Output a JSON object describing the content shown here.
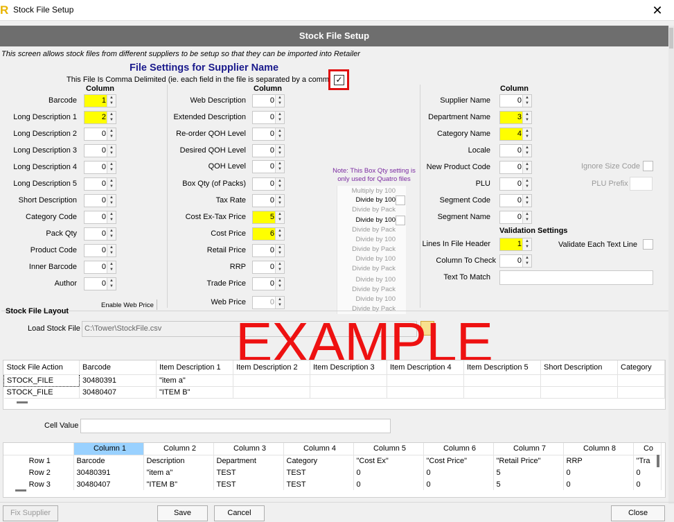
{
  "window": {
    "app_logo": "R",
    "title": "Stock File Setup",
    "close_glyph": "✕"
  },
  "banner": "Stock File Setup",
  "description": "This screen allows stock files from different suppliers to be setup so that they can be imported into Retailer",
  "file_settings_title": "File Settings for Supplier Name",
  "comma_delimited": {
    "label": "This File Is Comma Delimited (ie. each field in the file is separated by a comma)",
    "checked": true,
    "check_glyph": "✓"
  },
  "column_header": "Column",
  "spin_up": "▲",
  "spin_down": "▼",
  "left_fields": [
    {
      "label": "Barcode",
      "value": "1",
      "highlight": true
    },
    {
      "label": "Long Description 1",
      "value": "2",
      "highlight": true
    },
    {
      "label": "Long Description 2",
      "value": "0"
    },
    {
      "label": "Long Description 3",
      "value": "0"
    },
    {
      "label": "Long Description 4",
      "value": "0"
    },
    {
      "label": "Long Description 5",
      "value": "0"
    },
    {
      "label": "Short Description",
      "value": "0"
    },
    {
      "label": "Category Code",
      "value": "0"
    },
    {
      "label": "Pack Qty",
      "value": "0"
    },
    {
      "label": "Product Code",
      "value": "0"
    },
    {
      "label": "Inner Barcode",
      "value": "0"
    },
    {
      "label": "Author",
      "value": "0"
    }
  ],
  "middle_fields": [
    {
      "label": "Web Description",
      "value": "0"
    },
    {
      "label": "Extended Description",
      "value": "0"
    },
    {
      "label": "Re-order QOH Level",
      "value": "0"
    },
    {
      "label": "Desired QOH Level",
      "value": "0"
    },
    {
      "label": "QOH Level",
      "value": "0"
    },
    {
      "label": "Box Qty (of Packs)",
      "value": "0"
    },
    {
      "label": "Tax Rate",
      "value": "0"
    },
    {
      "label": "Cost Ex-Tax Price",
      "value": "5",
      "highlight": true
    },
    {
      "label": "Cost Price",
      "value": "6",
      "highlight": true
    },
    {
      "label": "Retail Price",
      "value": "0"
    },
    {
      "label": "RRP",
      "value": "0"
    },
    {
      "label": "Trade Price",
      "value": "0"
    },
    {
      "label": "Web Price",
      "value": "0",
      "disabled": true
    }
  ],
  "enable_web_price": "Enable Web Price",
  "box_qty_note": "Note: This Box Qty setting is only used for Quatro files",
  "box_qty_options": [
    {
      "text": "Multiply by 100",
      "active": false
    },
    {
      "text": "Divide by 100",
      "active": true
    },
    {
      "text": "Divide by Pack",
      "active": false
    },
    {
      "text": "Divide by 100",
      "active": true
    },
    {
      "text": "Divide by Pack",
      "active": false
    },
    {
      "text": "Divide by 100",
      "active": false
    },
    {
      "text": "Divide by Pack",
      "active": false
    },
    {
      "text": "Divide by 100",
      "active": false
    },
    {
      "text": "Divide by Pack",
      "active": false
    },
    {
      "text": "Divide by 100",
      "active": false
    },
    {
      "text": "Divide by Pack",
      "active": false
    },
    {
      "text": "Divide by 100",
      "active": false
    },
    {
      "text": "Divide by Pack",
      "active": false
    }
  ],
  "right_fields": [
    {
      "label": "Supplier Name",
      "value": "0"
    },
    {
      "label": "Department Name",
      "value": "3",
      "highlight": true
    },
    {
      "label": "Category Name",
      "value": "4",
      "highlight": true
    },
    {
      "label": "Locale",
      "value": "0"
    },
    {
      "label": "New Product Code",
      "value": "0"
    },
    {
      "label": "PLU",
      "value": "0"
    },
    {
      "label": "Segment Code",
      "value": "0"
    },
    {
      "label": "Segment Name",
      "value": "0"
    }
  ],
  "ignore_size_code": "Ignore Size Code",
  "plu_prefix": "PLU Prefix",
  "validation": {
    "title": "Validation Settings",
    "lines_in_header_label": "Lines In File Header",
    "lines_in_header_value": "1",
    "column_to_check_label": "Column To Check",
    "column_to_check_value": "0",
    "text_to_match_label": "Text To Match",
    "text_to_match_value": "",
    "validate_each_label": "Validate Each Text Line"
  },
  "stock_file_layout": {
    "title": "Stock File Layout",
    "load_label": "Load Stock File",
    "path": "C:\\Tower\\StockFile.csv"
  },
  "watermark": "EXAMPLE",
  "grid1": {
    "columns": [
      "Stock File Action",
      "Barcode",
      "Item Description 1",
      "Item Description 2",
      "Item Description 3",
      "Item Description 4",
      "Item Description 5",
      "Short Description",
      "Category"
    ],
    "rows": [
      [
        "STOCK_FILE",
        "30480391",
        "\"item a\"",
        "",
        "",
        "",
        "",
        "",
        ""
      ],
      [
        "STOCK_FILE",
        "30480407",
        "\"ITEM B\"",
        "",
        "",
        "",
        "",
        "",
        ""
      ]
    ]
  },
  "cell_value": {
    "label": "Cell Value",
    "value": ""
  },
  "grid2": {
    "columns": [
      "Column 1",
      "Column 2",
      "Column 3",
      "Column 4",
      "Column 5",
      "Column 6",
      "Column 7",
      "Column 8",
      "Co"
    ],
    "rows": [
      {
        "label": "Row 1",
        "cells": [
          "Barcode",
          "Description",
          "Department",
          "Category",
          "\"Cost Ex\"",
          "\"Cost Price\"",
          "\"Retail Price\"",
          "RRP",
          "\"Tra"
        ]
      },
      {
        "label": "Row 2",
        "cells": [
          "30480391",
          "\"item a\"",
          "TEST",
          "TEST",
          "0",
          "0",
          "5",
          "0",
          "0"
        ]
      },
      {
        "label": "Row 3",
        "cells": [
          "30480407",
          "\"ITEM B\"",
          "TEST",
          "TEST",
          "0",
          "0",
          "5",
          "0",
          "0"
        ]
      }
    ]
  },
  "buttons": {
    "fix_supplier": "Fix Supplier",
    "save": "Save",
    "cancel": "Cancel",
    "close": "Close"
  },
  "colors": {
    "highlight": "#ffff00",
    "banner": "#6e6e6e",
    "title": "#1a1a8c",
    "watermark": "#ee1111",
    "selected_col": "#99d1ff",
    "note": "#7a2aa0"
  }
}
